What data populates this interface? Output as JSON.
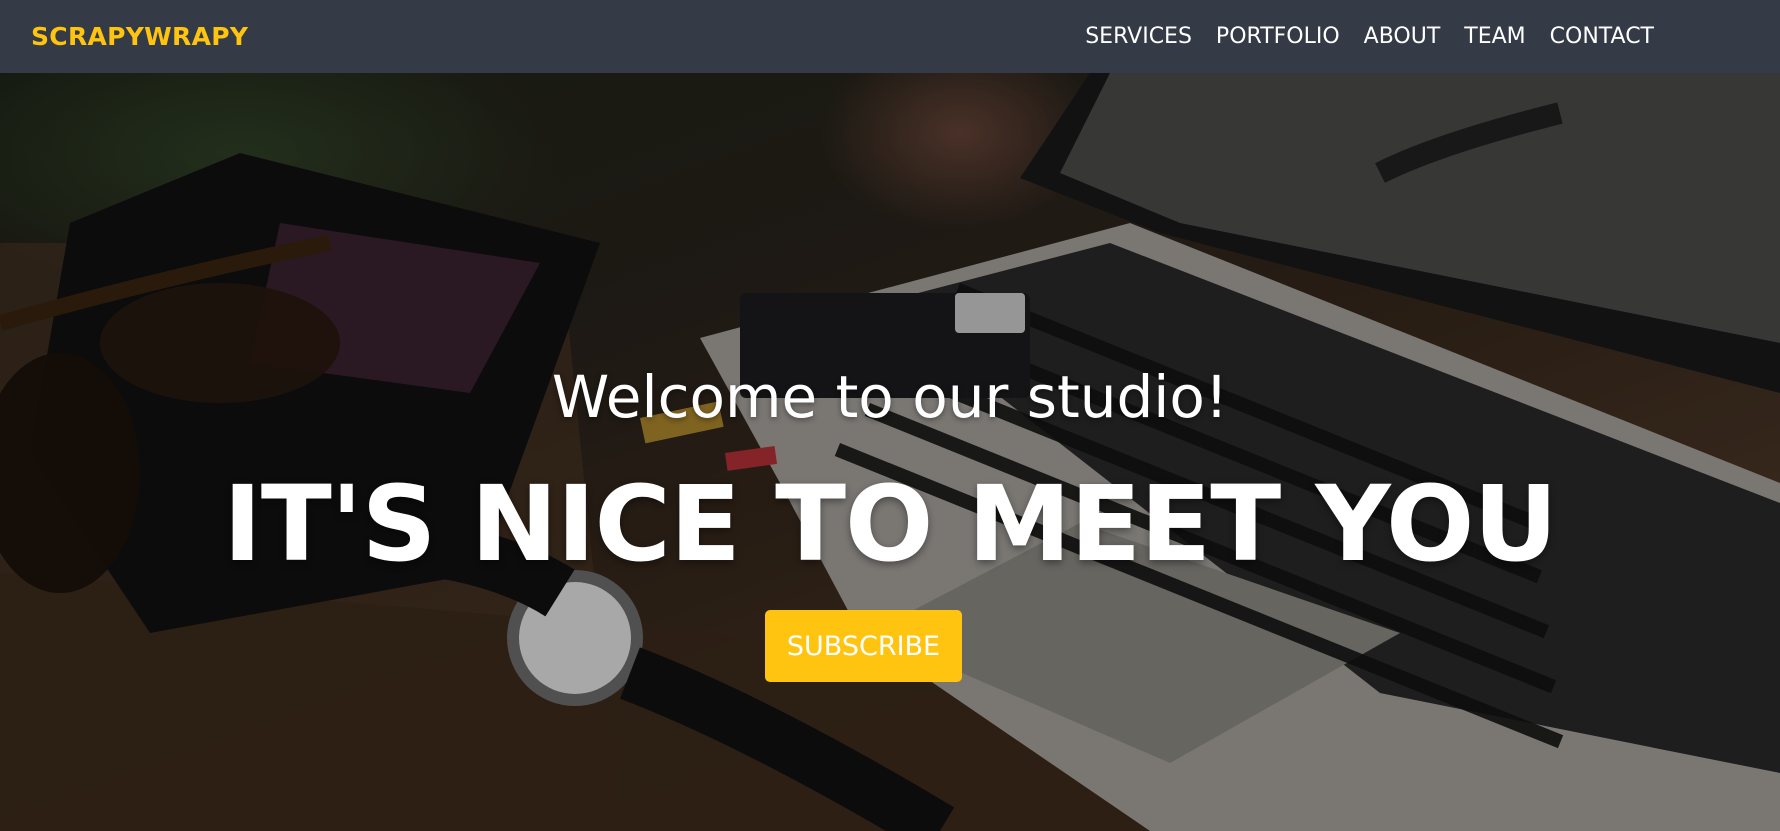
{
  "navbar": {
    "brand": "SCRAPYWRAPY",
    "links": [
      "SERVICES",
      "PORTFOLIO",
      "ABOUT",
      "TEAM",
      "CONTACT"
    ]
  },
  "hero": {
    "subheading": "Welcome to our studio!",
    "heading": "IT'S NICE TO MEET YOU",
    "button_label": "SUBSCRIBE",
    "background_description_icon": "desk-laptop-photo"
  },
  "colors": {
    "navbar_bg": "#343a46",
    "brand": "#fec40f",
    "button_bg": "#fec40f",
    "text": "#ffffff"
  }
}
